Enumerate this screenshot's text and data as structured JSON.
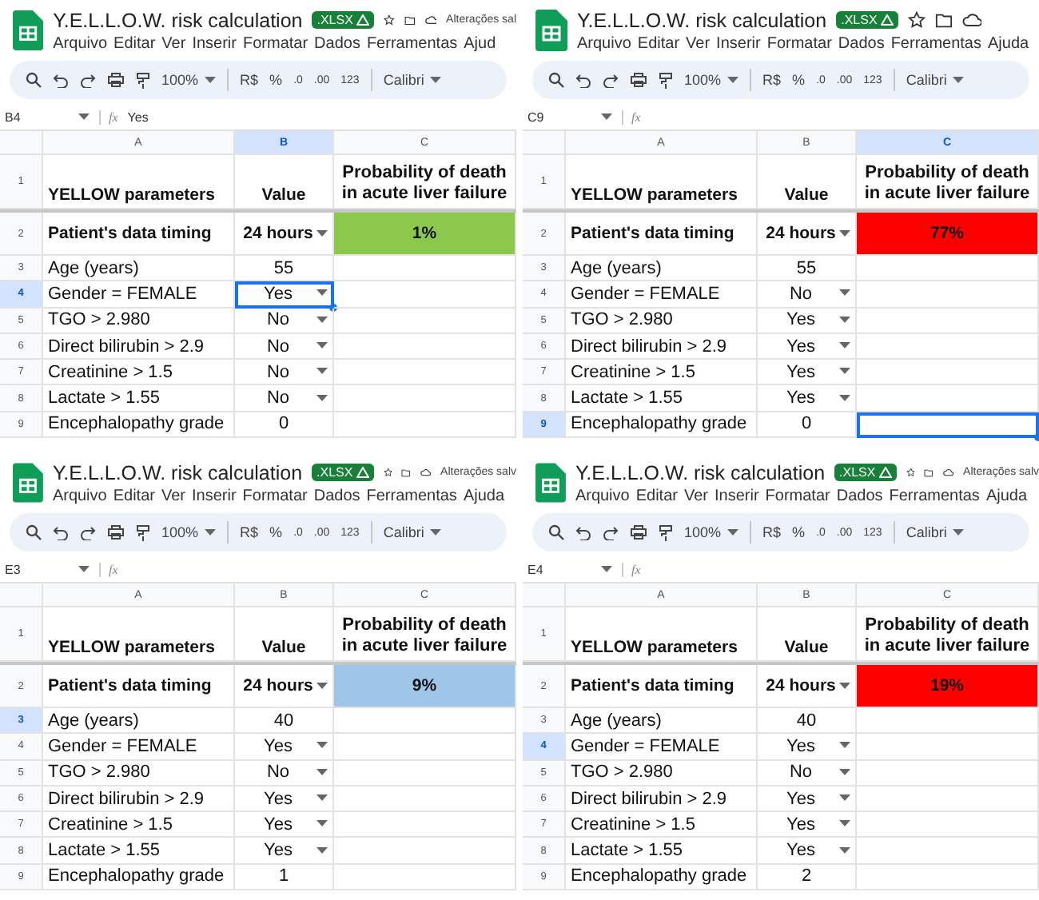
{
  "panels": [
    {
      "title": "Y.E.L.L.O.W. risk calculation",
      "badge": ".XLSX",
      "status": "Alterações sal",
      "menu": [
        "Arquivo",
        "Editar",
        "Ver",
        "Inserir",
        "Formatar",
        "Dados",
        "Ferramentas",
        "Ajud"
      ],
      "toolbar": {
        "zoom": "100%",
        "items": [
          "R$",
          "%",
          ".0",
          ".00",
          "123"
        ],
        "font": "Calibri"
      },
      "name_box": "B4",
      "fx": "fx",
      "formula": "Yes",
      "columns": [
        {
          "label": "A",
          "selected": false
        },
        {
          "label": "B",
          "selected": true
        },
        {
          "label": "C",
          "selected": false
        }
      ],
      "rows": [
        {
          "number": "1",
          "kind": "header",
          "label": "YELLOW parameters",
          "value": "Value",
          "result": "Probability of death in acute liver failure",
          "dropdown": false,
          "selected": false,
          "value_selected": false,
          "result_selected": false
        },
        {
          "number": "2",
          "kind": "timing",
          "label": "Patient's data timing",
          "value": "24 hours",
          "result": "1%",
          "color": "#8cc84b",
          "dropdown": true,
          "selected": false,
          "value_selected": false,
          "result_selected": false
        },
        {
          "number": "3",
          "kind": "param",
          "label": "Age (years)",
          "value": "55",
          "dropdown": false,
          "selected": false,
          "value_selected": false,
          "result_selected": false
        },
        {
          "number": "4",
          "kind": "param",
          "label": "Gender = FEMALE",
          "value": "Yes",
          "dropdown": true,
          "selected": true,
          "value_selected": true,
          "result_selected": false
        },
        {
          "number": "5",
          "kind": "param",
          "label": "TGO > 2.980",
          "value": "No",
          "dropdown": true,
          "selected": false,
          "value_selected": false,
          "result_selected": false
        },
        {
          "number": "6",
          "kind": "param",
          "label": "Direct bilirubin > 2.9",
          "value": "No",
          "dropdown": true,
          "selected": false,
          "value_selected": false,
          "result_selected": false
        },
        {
          "number": "7",
          "kind": "param",
          "label": "Creatinine > 1.5",
          "value": "No",
          "dropdown": true,
          "selected": false,
          "value_selected": false,
          "result_selected": false
        },
        {
          "number": "8",
          "kind": "param",
          "label": "Lactate > 1.55",
          "value": "No",
          "dropdown": true,
          "selected": false,
          "value_selected": false,
          "result_selected": false
        },
        {
          "number": "9",
          "kind": "param",
          "label": "Encephalopathy grade",
          "value": "0",
          "dropdown": false,
          "selected": false,
          "value_selected": false,
          "result_selected": false
        }
      ]
    },
    {
      "title": "Y.E.L.L.O.W. risk calculation",
      "badge": ".XLSX",
      "menu": [
        "Arquivo",
        "Editar",
        "Ver",
        "Inserir",
        "Formatar",
        "Dados",
        "Ferramentas",
        "Ajuda"
      ],
      "toolbar": {
        "zoom": "100%",
        "items": [
          "R$",
          "%",
          ".0",
          ".00",
          "123"
        ],
        "font": "Calibri"
      },
      "name_box": "C9",
      "fx": "fx",
      "columns": [
        {
          "label": "A",
          "selected": false
        },
        {
          "label": "B",
          "selected": false
        },
        {
          "label": "C",
          "selected": true
        }
      ],
      "rows": [
        {
          "number": "1",
          "kind": "header",
          "label": "YELLOW parameters",
          "value": "Value",
          "result": "Probability of death in acute liver failure",
          "dropdown": false,
          "selected": false,
          "value_selected": false,
          "result_selected": false
        },
        {
          "number": "2",
          "kind": "timing",
          "label": "Patient's data timing",
          "value": "24 hours",
          "result": "77%",
          "color": "#ff0000",
          "dropdown": true,
          "selected": false,
          "value_selected": false,
          "result_selected": false
        },
        {
          "number": "3",
          "kind": "param",
          "label": "Age (years)",
          "value": "55",
          "dropdown": false,
          "selected": false,
          "value_selected": false,
          "result_selected": false
        },
        {
          "number": "4",
          "kind": "param",
          "label": "Gender = FEMALE",
          "value": "No",
          "dropdown": true,
          "selected": false,
          "value_selected": false,
          "result_selected": false
        },
        {
          "number": "5",
          "kind": "param",
          "label": "TGO > 2.980",
          "value": "Yes",
          "dropdown": true,
          "selected": false,
          "value_selected": false,
          "result_selected": false
        },
        {
          "number": "6",
          "kind": "param",
          "label": "Direct bilirubin > 2.9",
          "value": "Yes",
          "dropdown": true,
          "selected": false,
          "value_selected": false,
          "result_selected": false
        },
        {
          "number": "7",
          "kind": "param",
          "label": "Creatinine > 1.5",
          "value": "Yes",
          "dropdown": true,
          "selected": false,
          "value_selected": false,
          "result_selected": false
        },
        {
          "number": "8",
          "kind": "param",
          "label": "Lactate > 1.55",
          "value": "Yes",
          "dropdown": true,
          "selected": false,
          "value_selected": false,
          "result_selected": false
        },
        {
          "number": "9",
          "kind": "param",
          "label": "Encephalopathy grade",
          "value": "0",
          "dropdown": false,
          "selected": true,
          "value_selected": false,
          "result_selected": true
        }
      ]
    },
    {
      "title": "Y.E.L.L.O.W. risk calculation",
      "badge": ".XLSX",
      "status": "Alterações salv",
      "menu": [
        "Arquivo",
        "Editar",
        "Ver",
        "Inserir",
        "Formatar",
        "Dados",
        "Ferramentas",
        "Ajuda"
      ],
      "toolbar": {
        "zoom": "100%",
        "items": [
          "R$",
          "%",
          ".0",
          ".00",
          "123"
        ],
        "font": "Calibri"
      },
      "name_box": "E3",
      "fx": "fx",
      "columns": [
        {
          "label": "A",
          "selected": false
        },
        {
          "label": "B",
          "selected": false
        },
        {
          "label": "C",
          "selected": false
        }
      ],
      "rows": [
        {
          "number": "1",
          "kind": "header",
          "label": "YELLOW parameters",
          "value": "Value",
          "result": "Probability of death in acute liver failure",
          "dropdown": false,
          "selected": false,
          "value_selected": false,
          "result_selected": false
        },
        {
          "number": "2",
          "kind": "timing",
          "label": "Patient's data timing",
          "value": "24 hours",
          "result": "9%",
          "color": "#9fc5e8",
          "dropdown": true,
          "selected": false,
          "value_selected": false,
          "result_selected": false
        },
        {
          "number": "3",
          "kind": "param",
          "label": "Age (years)",
          "value": "40",
          "dropdown": false,
          "selected": true,
          "value_selected": false,
          "result_selected": false
        },
        {
          "number": "4",
          "kind": "param",
          "label": "Gender = FEMALE",
          "value": "Yes",
          "dropdown": true,
          "selected": false,
          "value_selected": false,
          "result_selected": false
        },
        {
          "number": "5",
          "kind": "param",
          "label": "TGO > 2.980",
          "value": "No",
          "dropdown": true,
          "selected": false,
          "value_selected": false,
          "result_selected": false
        },
        {
          "number": "6",
          "kind": "param",
          "label": "Direct bilirubin > 2.9",
          "value": "Yes",
          "dropdown": true,
          "selected": false,
          "value_selected": false,
          "result_selected": false
        },
        {
          "number": "7",
          "kind": "param",
          "label": "Creatinine > 1.5",
          "value": "Yes",
          "dropdown": true,
          "selected": false,
          "value_selected": false,
          "result_selected": false
        },
        {
          "number": "8",
          "kind": "param",
          "label": "Lactate > 1.55",
          "value": "Yes",
          "dropdown": true,
          "selected": false,
          "value_selected": false,
          "result_selected": false
        },
        {
          "number": "9",
          "kind": "param",
          "label": "Encephalopathy grade",
          "value": "1",
          "dropdown": false,
          "selected": false,
          "value_selected": false,
          "result_selected": false
        }
      ]
    },
    {
      "title": "Y.E.L.L.O.W. risk calculation",
      "badge": ".XLSX",
      "status": "Alterações salv",
      "menu": [
        "Arquivo",
        "Editar",
        "Ver",
        "Inserir",
        "Formatar",
        "Dados",
        "Ferramentas",
        "Ajuda"
      ],
      "toolbar": {
        "zoom": "100%",
        "items": [
          "R$",
          "%",
          ".0",
          ".00",
          "123"
        ],
        "font": "Calibri"
      },
      "name_box": "E4",
      "fx": "fx",
      "columns": [
        {
          "label": "A",
          "selected": false
        },
        {
          "label": "B",
          "selected": false
        },
        {
          "label": "C",
          "selected": false
        }
      ],
      "rows": [
        {
          "number": "1",
          "kind": "header",
          "label": "YELLOW parameters",
          "value": "Value",
          "result": "Probability of death in acute liver failure",
          "dropdown": false,
          "selected": false,
          "value_selected": false,
          "result_selected": false
        },
        {
          "number": "2",
          "kind": "timing",
          "label": "Patient's data timing",
          "value": "24 hours",
          "result": "19%",
          "color": "#ff0000",
          "dropdown": true,
          "selected": false,
          "value_selected": false,
          "result_selected": false
        },
        {
          "number": "3",
          "kind": "param",
          "label": "Age (years)",
          "value": "40",
          "dropdown": false,
          "selected": false,
          "value_selected": false,
          "result_selected": false
        },
        {
          "number": "4",
          "kind": "param",
          "label": "Gender = FEMALE",
          "value": "Yes",
          "dropdown": true,
          "selected": true,
          "value_selected": false,
          "result_selected": false
        },
        {
          "number": "5",
          "kind": "param",
          "label": "TGO > 2.980",
          "value": "No",
          "dropdown": true,
          "selected": false,
          "value_selected": false,
          "result_selected": false
        },
        {
          "number": "6",
          "kind": "param",
          "label": "Direct bilirubin > 2.9",
          "value": "Yes",
          "dropdown": true,
          "selected": false,
          "value_selected": false,
          "result_selected": false
        },
        {
          "number": "7",
          "kind": "param",
          "label": "Creatinine > 1.5",
          "value": "Yes",
          "dropdown": true,
          "selected": false,
          "value_selected": false,
          "result_selected": false
        },
        {
          "number": "8",
          "kind": "param",
          "label": "Lactate > 1.55",
          "value": "Yes",
          "dropdown": true,
          "selected": false,
          "value_selected": false,
          "result_selected": false
        },
        {
          "number": "9",
          "kind": "param",
          "label": "Encephalopathy grade",
          "value": "2",
          "dropdown": false,
          "selected": false,
          "value_selected": false,
          "result_selected": false
        }
      ]
    }
  ]
}
